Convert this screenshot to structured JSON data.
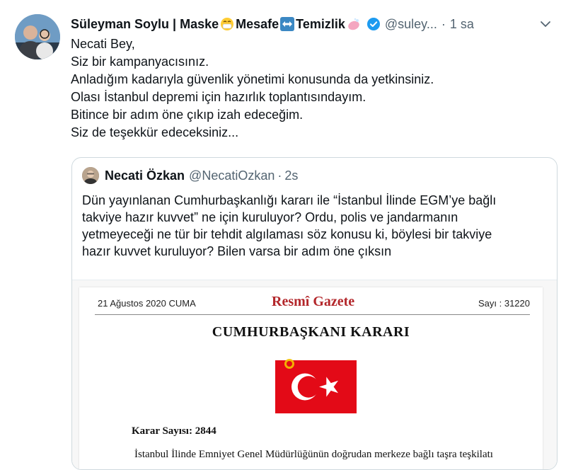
{
  "tweet": {
    "author_name": "Süleyman Soylu | Maske",
    "author_name_part2": "Mesafe",
    "author_name_part3": "Temizlik",
    "handle": "@suley...",
    "separator": "·",
    "time": "1 sa",
    "lines": [
      "Necati Bey,",
      "Siz bir kampanyacısınız.",
      "Anladığım kadarıyla güvenlik yönetimi konusunda da yetkinsiniz.",
      "Olası İstanbul depremi için hazırlık toplantısındayım.",
      "Bitince bir adım öne çıkıp izah edeceğim.",
      "Siz de teşekkür edeceksiniz..."
    ],
    "icons": [
      "mask-emoji-icon",
      "left-right-arrow-icon",
      "soap-icon",
      "verified-badge-icon",
      "chevron-down-icon"
    ]
  },
  "quoted": {
    "author_name": "Necati Özkan",
    "handle": "@NecatiOzkan",
    "separator": "·",
    "time": "2s",
    "lines": [
      "Dün yayınlanan Cumhurbaşkanlığı kararı ile  “İstanbul İlinde EGM’ye bağlı",
      "takviye hazır kuvvet” ne için kuruluyor? Ordu, polis ve jandarmanın",
      "yetmeyeceği ne tür bir tehdit algılaması söz konusu ki, böylesi bir takviye",
      "hazır kuvvet kuruluyor? Bilen varsa bir adım öne çıksın"
    ]
  },
  "document": {
    "date": "21 Ağustos 2020 CUMA",
    "title": "Resmî Gazete",
    "issue": "Sayı : 31220",
    "heading": "CUMHURBAŞKANI KARARI",
    "decision_number": "Karar Sayısı: 2844",
    "body_line": "İstanbul İlinde Emniyet Genel Müdürlüğünün doğrudan merkeze bağlı taşra teşkilatı",
    "colors": {
      "title": "#b3272b",
      "flag_red": "#e30a17"
    }
  },
  "colors": {
    "text": "#0f1419",
    "secondary": "#536471",
    "verified": "#1d9bf0",
    "border": "#cfd9de"
  }
}
